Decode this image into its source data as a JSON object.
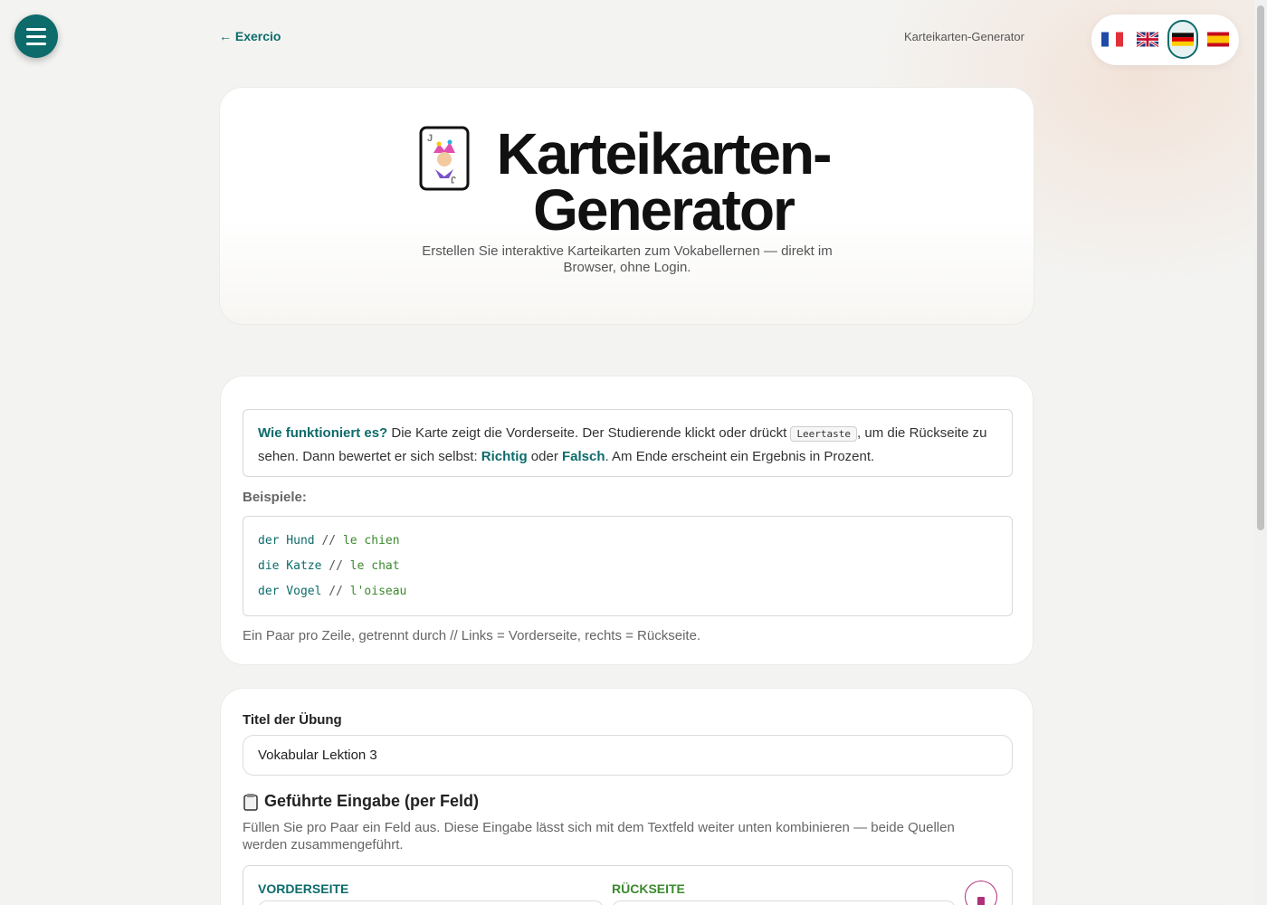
{
  "nav": {
    "back_label": "← Exercio",
    "page_title": "Karteikarten-Generator",
    "languages": [
      "fr",
      "en",
      "de",
      "es"
    ],
    "active_language": "de"
  },
  "hero": {
    "title": "Karteikarten-Generator",
    "subtitle": "Erstellen Sie interaktive Karteikarten zum Vokabellernen — direkt im Browser, ohne Login."
  },
  "info": {
    "how_title": "Wie funktioniert es?",
    "how_text_1": " Die Karte zeigt die Vorderseite. Der Studierende klickt oder drückt ",
    "how_key": "Leertaste",
    "how_text_2": ", um die Rückseite zu sehen. Dann bewertet er sich selbst: ",
    "how_correct": "Richtig",
    "how_or": " oder ",
    "how_wrong": "Falsch",
    "how_text_3": ". Am Ende erscheint ein Ergebnis in Prozent.",
    "examples_label": "Beispiele:",
    "examples": [
      {
        "front": "der Hund",
        "sep": " // ",
        "back": "le chien"
      },
      {
        "front": "die Katze",
        "sep": " // ",
        "back": "le chat"
      },
      {
        "front": "der Vogel",
        "sep": " // ",
        "back": "l'oiseau"
      }
    ],
    "hint": "Ein Paar pro Zeile, getrennt durch // Links = Vorderseite, rechts = Rückseite."
  },
  "form": {
    "title_label": "Titel der Übung",
    "title_value": "Vokabular Lektion 3",
    "guided_heading": "Geführte Eingabe (per Feld)",
    "guided_desc": "Füllen Sie pro Paar ein Feld aus. Diese Eingabe lässt sich mit dem Textfeld weiter unten kombinieren — beide Quellen werden zusammengeführt.",
    "col_front": "VORDERSEITE",
    "col_back": "RÜCKSEITE"
  },
  "colors": {
    "accent": "#0d6b6b",
    "back_accent": "#3c8a2e",
    "delete": "#b0307a"
  },
  "icons": {
    "menu": "hamburger-icon",
    "hero": "joker-card-icon",
    "guided": "clipboard-icon",
    "delete": "trash-icon"
  }
}
